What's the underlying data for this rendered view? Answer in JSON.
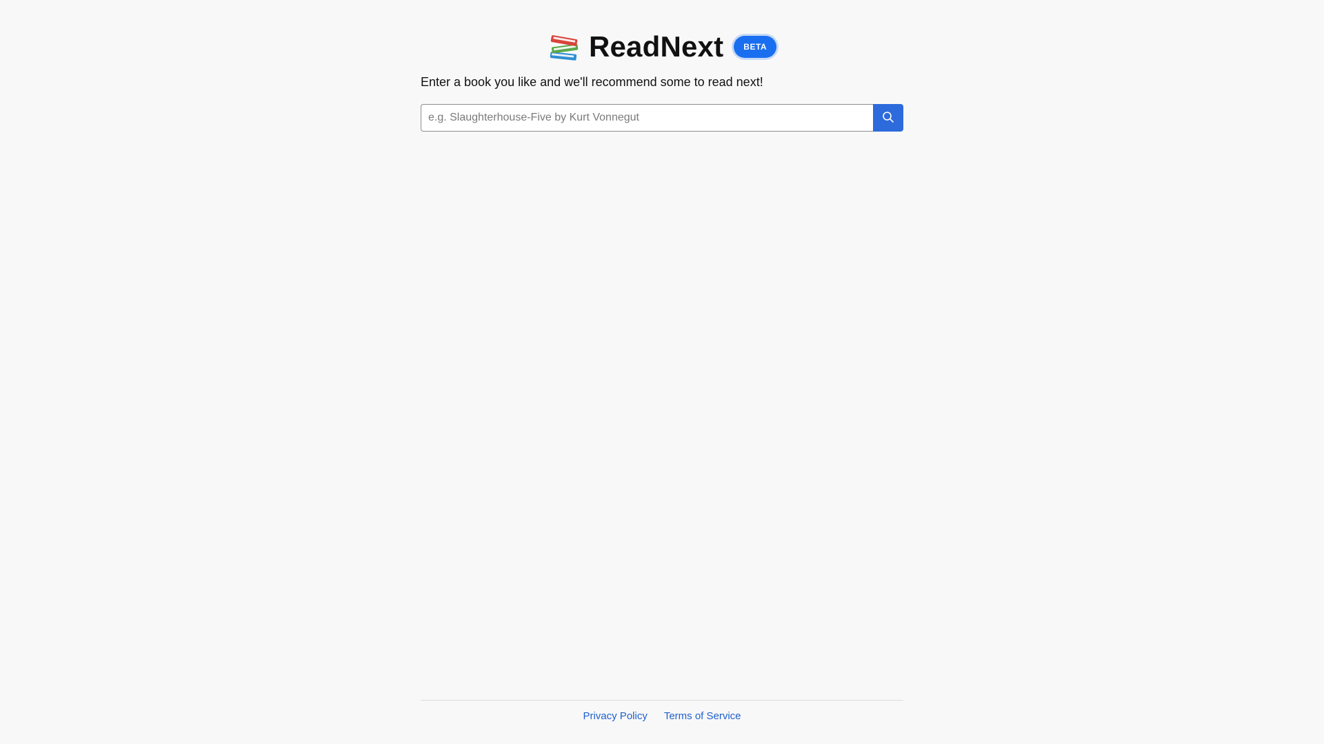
{
  "header": {
    "logo_icon": "books-stack-icon",
    "title": "ReadNext",
    "badge": "BETA"
  },
  "main": {
    "tagline": "Enter a book you like and we'll recommend some to read next!",
    "search": {
      "value": "",
      "placeholder": "e.g. Slaughterhouse-Five by Kurt Vonnegut",
      "button_icon": "search-icon"
    }
  },
  "footer": {
    "links": [
      {
        "label": "Privacy Policy"
      },
      {
        "label": "Terms of Service"
      }
    ]
  },
  "colors": {
    "background": "#f8f8f8",
    "accent": "#2d6bdc",
    "badge": "#1a6ff0",
    "link": "#1f5fcc"
  }
}
